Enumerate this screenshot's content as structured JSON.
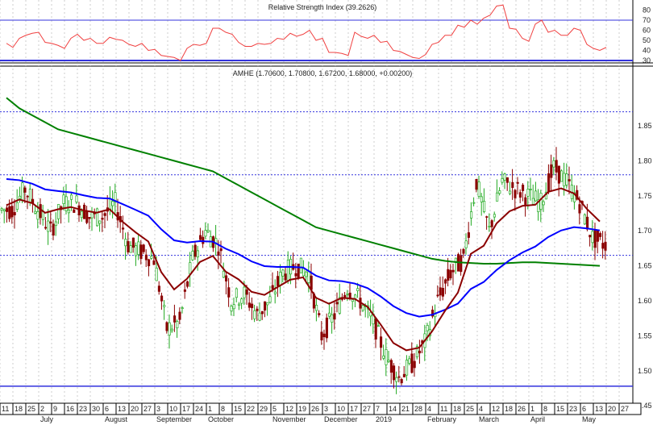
{
  "chart_data": {
    "type": "candlestick",
    "rsi": {
      "title": "Relative Strength Index (39.2626)",
      "ticks": [
        30,
        40,
        50,
        60,
        70,
        80
      ],
      "upper": 70,
      "lower": 30,
      "values": [
        47,
        52,
        57,
        48,
        45,
        52,
        50,
        47,
        53,
        50,
        44,
        40,
        35,
        33,
        42,
        45,
        62,
        58,
        48,
        44,
        46,
        52,
        57,
        56,
        50,
        38,
        37,
        58,
        52,
        48,
        40,
        36,
        32,
        46,
        55,
        65,
        70,
        72,
        84,
        62,
        52,
        66,
        58,
        55,
        62,
        46,
        40
      ]
    },
    "price": {
      "title": "AMHE (1.70600, 1.70800, 1.67200, 1.68000, +0.00200)",
      "ticks": [
        "1.45",
        "1.50",
        "1.55",
        "1.60",
        "1.65",
        "1.70",
        "1.75",
        "1.80",
        "1.85"
      ],
      "ylim": [
        1.43,
        1.93
      ],
      "levels": {
        "dotted": [
          1.87,
          1.78,
          1.665
        ],
        "solid": [
          1.478
        ]
      },
      "weekly_close": [
        1.73,
        1.76,
        1.73,
        1.7,
        1.74,
        1.74,
        1.72,
        1.72,
        1.74,
        1.68,
        1.67,
        1.66,
        1.56,
        1.57,
        1.66,
        1.7,
        1.68,
        1.6,
        1.61,
        1.58,
        1.6,
        1.64,
        1.65,
        1.64,
        1.55,
        1.58,
        1.62,
        1.6,
        1.57,
        1.52,
        1.49,
        1.51,
        1.54,
        1.6,
        1.64,
        1.66,
        1.77,
        1.7,
        1.77,
        1.76,
        1.75,
        1.74,
        1.79,
        1.77,
        1.74,
        1.69,
        1.68
      ],
      "ma_long": [
        1.89,
        1.875,
        1.865,
        1.855,
        1.845,
        1.84,
        1.835,
        1.83,
        1.825,
        1.82,
        1.815,
        1.81,
        1.805,
        1.8,
        1.795,
        1.79,
        1.785,
        1.775,
        1.765,
        1.755,
        1.745,
        1.735,
        1.725,
        1.715,
        1.705,
        1.7,
        1.695,
        1.69,
        1.685,
        1.68,
        1.675,
        1.67,
        1.665,
        1.66,
        1.657,
        1.655,
        1.654,
        1.653,
        1.653,
        1.654,
        1.655,
        1.655,
        1.654,
        1.653,
        1.652,
        1.651,
        1.65
      ],
      "ma_short_color": "#8b0000",
      "ma_mid_color": "#0000ff",
      "ma_long_color": "#008000"
    },
    "x_ticks": [
      "11",
      "18",
      "25",
      "2",
      "9",
      "16",
      "23",
      "30",
      "6",
      "13",
      "20",
      "27",
      "3",
      "10",
      "17",
      "24",
      "1",
      "8",
      "15",
      "22",
      "29",
      "5",
      "12",
      "19",
      "26",
      "3",
      "10",
      "17",
      "27",
      "7",
      "14",
      "21",
      "28",
      "4",
      "11",
      "18",
      "25",
      "4",
      "12",
      "18",
      "26",
      "1",
      "8",
      "15",
      "23",
      "6",
      "13",
      "20",
      "27"
    ],
    "months": [
      {
        "label": "July",
        "week": 3
      },
      {
        "label": "August",
        "week": 8
      },
      {
        "label": "September",
        "week": 12
      },
      {
        "label": "October",
        "week": 16
      },
      {
        "label": "November",
        "week": 21
      },
      {
        "label": "December",
        "week": 25
      },
      {
        "label": "2019",
        "week": 29
      },
      {
        "label": "February",
        "week": 33
      },
      {
        "label": "March",
        "week": 37
      },
      {
        "label": "April",
        "week": 41
      },
      {
        "label": "May",
        "week": 45
      }
    ]
  }
}
